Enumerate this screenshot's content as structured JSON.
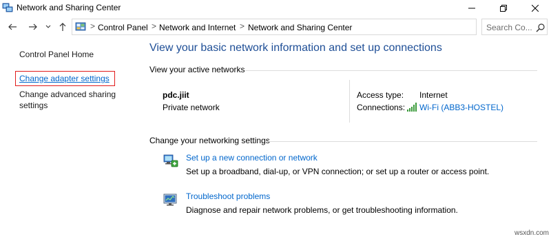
{
  "window": {
    "title": "Network and Sharing Center",
    "icon": "network-sharing-icon",
    "controls": {
      "minimize": "minimize-icon",
      "maximize": "restore-icon",
      "close": "close-icon"
    }
  },
  "nav": {
    "back": "back-arrow-icon",
    "forward": "forward-arrow-icon",
    "recent": "chevron-down-icon",
    "up": "up-arrow-icon"
  },
  "address": {
    "icon": "control-panel-icon",
    "separator": ">",
    "breadcrumbs": [
      "Control Panel",
      "Network and Internet",
      "Network and Sharing Center"
    ]
  },
  "search": {
    "placeholder": "Search Co..."
  },
  "sidebar": {
    "items": [
      {
        "label": "Control Panel Home"
      },
      {
        "label": "Change adapter settings"
      },
      {
        "label": "Change advanced sharing settings"
      }
    ]
  },
  "main": {
    "heading": "View your basic network information and set up connections",
    "active_networks_label": "View your active networks",
    "network": {
      "name": "pdc.jiit",
      "category": "Private network",
      "access_type_label": "Access type:",
      "access_type_value": "Internet",
      "connections_label": "Connections:",
      "connection_name": "Wi-Fi (ABB3-HOSTEL)"
    },
    "settings_label": "Change your networking settings",
    "tasks": [
      {
        "title": "Set up a new connection or network",
        "description": "Set up a broadband, dial-up, or VPN connection; or set up a router or access point.",
        "icon": "new-connection-icon"
      },
      {
        "title": "Troubleshoot problems",
        "description": "Diagnose and repair network problems, or get troubleshooting information.",
        "icon": "troubleshoot-icon"
      }
    ]
  },
  "watermark": "wsxdn.com",
  "colors": {
    "link": "#0066cc",
    "heading": "#1e4e96",
    "highlight_box": "#e11b1b"
  }
}
